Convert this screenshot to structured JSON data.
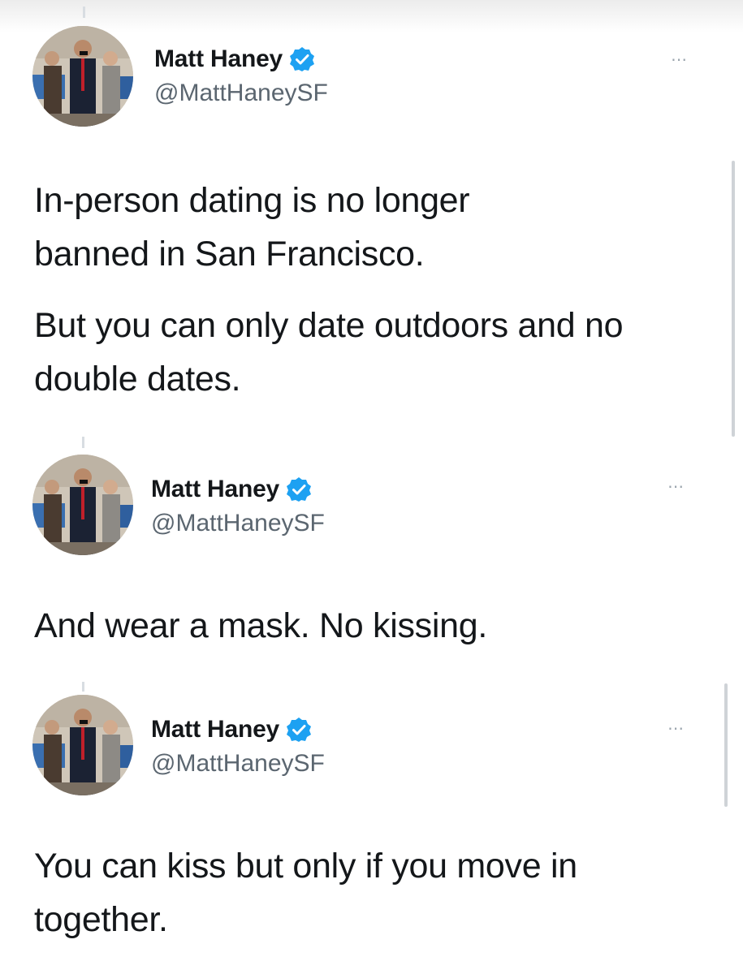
{
  "tweets": [
    {
      "author": {
        "display_name": "Matt Haney",
        "handle": "@MattHaneySF",
        "verified": true
      },
      "more_icon": "⋯",
      "paragraphs": [
        "In-person dating is no longer banned in San Francisco.",
        "But you can only date outdoors and no double dates."
      ]
    },
    {
      "author": {
        "display_name": "Matt Haney",
        "handle": "@MattHaneySF",
        "verified": true
      },
      "more_icon": "⋯",
      "paragraphs": [
        "And wear a mask. No kissing."
      ]
    },
    {
      "author": {
        "display_name": "Matt Haney",
        "handle": "@MattHaneySF",
        "verified": true
      },
      "more_icon": "⋯",
      "paragraphs": [
        "You can kiss but only if you move in together."
      ]
    }
  ],
  "colors": {
    "verified_badge": "#1da1f2",
    "handle": "#5b6670",
    "text": "#14171a"
  },
  "icons": [
    "avatar-photo",
    "verified-badge-icon",
    "more-options-icon"
  ]
}
